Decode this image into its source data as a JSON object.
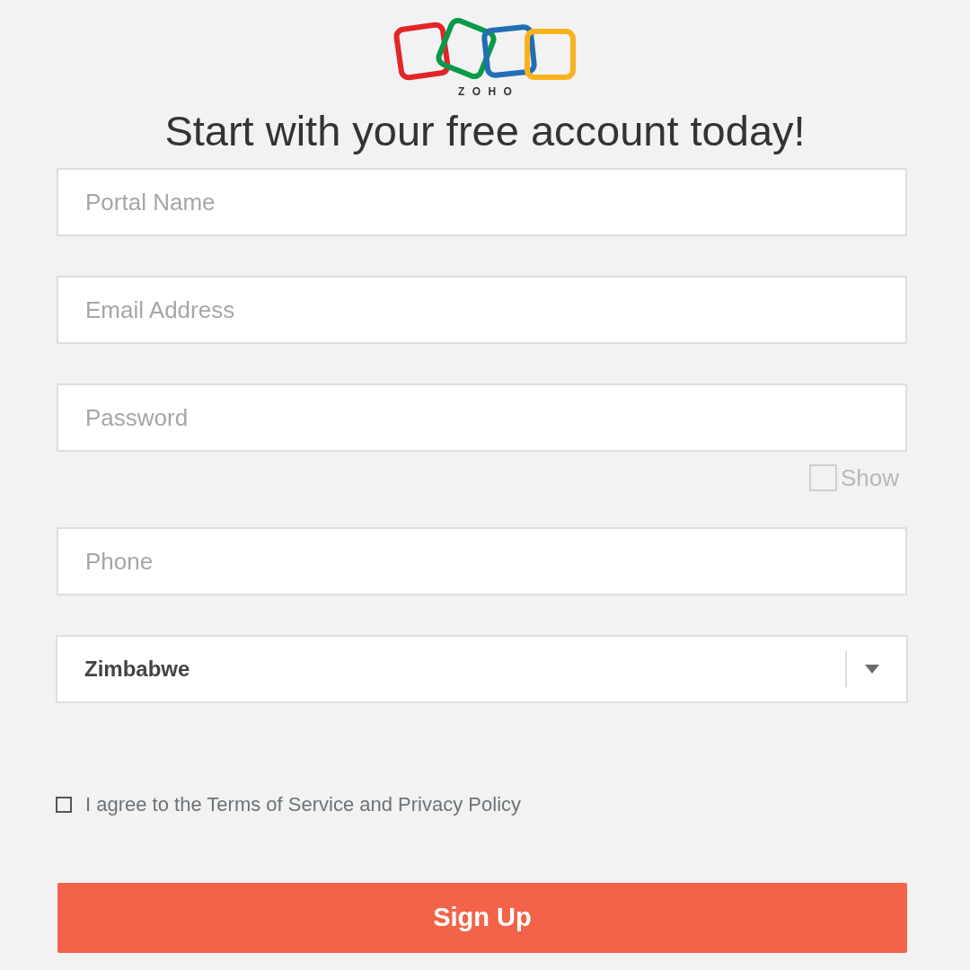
{
  "logo": {
    "text": "ZOHO"
  },
  "heading": "Start with your free account today!",
  "fields": [
    {
      "kind": "input",
      "placeholder": "Portal Name"
    },
    {
      "kind": "input",
      "placeholder": "Email Address"
    },
    {
      "kind": "input",
      "placeholder": "Password",
      "show": {
        "label": "Show",
        "checked": false
      }
    },
    {
      "kind": "input",
      "placeholder": "Phone"
    },
    {
      "kind": "select",
      "value": "Zimbabwe"
    }
  ],
  "terms": {
    "label": "I agree to the Terms of Service and Privacy Policy",
    "checked": false
  },
  "submit": "Sign Up"
}
